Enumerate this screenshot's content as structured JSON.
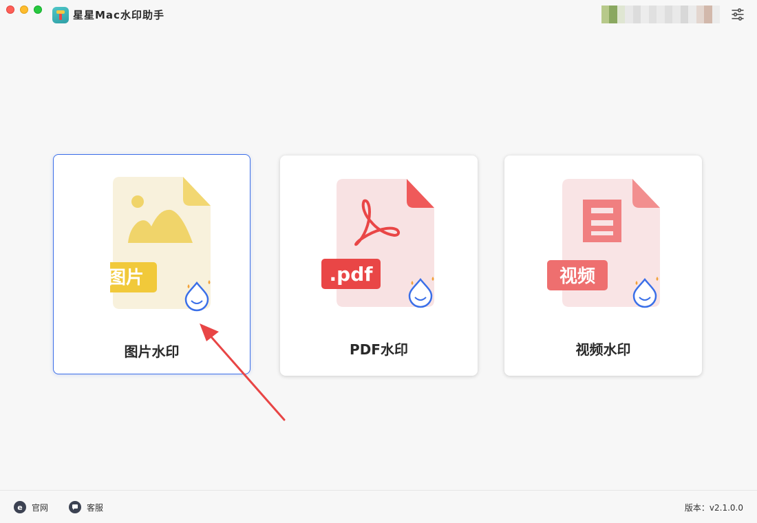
{
  "app": {
    "title": "星星Mac水印助手"
  },
  "cards": [
    {
      "label": "图片水印",
      "badge": "图片",
      "type": "image"
    },
    {
      "label": "PDF水印",
      "badge": ".pdf",
      "type": "pdf"
    },
    {
      "label": "视频水印",
      "badge": "视频",
      "type": "video"
    }
  ],
  "footer": {
    "website_label": "官网",
    "support_label": "客服",
    "version_label": "版本：v2.1.0.0"
  },
  "colors": {
    "accent": "#3b6ee8",
    "image_file": "#f8f1dc",
    "image_fold": "#f2d772",
    "image_badge": "#f1c93a",
    "pdf_file": "#f8e2e3",
    "pdf_fold": "#ef5a5a",
    "pdf_badge": "#e94646",
    "video_file": "#f9e4e5",
    "video_fold": "#f28f8f",
    "video_badge": "#ee6f6f",
    "drop": "#3a6fe8",
    "arrow": "#e84545"
  },
  "icons": {
    "settings": "sliders-icon",
    "website": "browser-e-icon",
    "support": "chat-bubble-icon",
    "watermark": "water-drop-icon"
  }
}
